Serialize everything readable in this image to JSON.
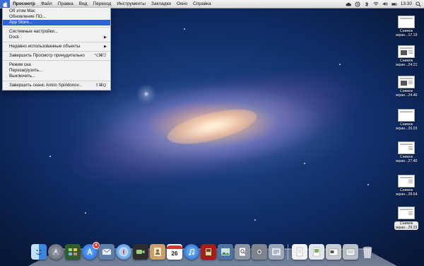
{
  "menubar": {
    "app_name": "Просмотр",
    "menus": [
      "Файл",
      "Правка",
      "Вид",
      "Переход",
      "Инструменты",
      "Закладки",
      "Окно",
      "Справка"
    ],
    "clock": "13:30"
  },
  "apple_menu": {
    "items": [
      {
        "label": "Об этом Mac"
      },
      {
        "label": "Обновление ПО..."
      },
      {
        "label": "App Store...",
        "selected": true
      },
      {
        "separator": true
      },
      {
        "label": "Системные настройки..."
      },
      {
        "label": "Dock",
        "submenu": true
      },
      {
        "separator": true
      },
      {
        "label": "Недавно использованные объекты",
        "submenu": true
      },
      {
        "separator": true
      },
      {
        "label": "Завершить Просмотр принудительно",
        "shortcut": "⌥⌘⎋"
      },
      {
        "separator": true
      },
      {
        "label": "Режим сна"
      },
      {
        "label": "Перезагрузить..."
      },
      {
        "label": "Выключить..."
      },
      {
        "separator": true
      },
      {
        "label": "Завершить сеанс Anton Spiridonov...",
        "shortcut": "⇧⌘Q"
      }
    ]
  },
  "desktop_icons": [
    {
      "line1": "Снимок",
      "line2": "экран...17.19"
    },
    {
      "line1": "Снимок",
      "line2": "экран...24.21"
    },
    {
      "line1": "Снимок",
      "line2": "экран...24.46"
    },
    {
      "line1": "Снимок",
      "line2": "экран...26.03"
    },
    {
      "line1": "Снимок",
      "line2": "экран...27.46"
    },
    {
      "line1": "Снимок",
      "line2": "экран...28.54"
    },
    {
      "line1": "Снимок",
      "line2": "экран...29.23",
      "selected": true
    }
  ],
  "dock": {
    "calendar_day": "26",
    "appstore_badge": "4",
    "apps": [
      {
        "icon": "finder-icon",
        "color": "#4a8fe0"
      },
      {
        "icon": "launchpad-icon",
        "color": "#7a7f88"
      },
      {
        "icon": "mission-control-icon",
        "color": "#3c6b3a"
      },
      {
        "icon": "app-store-icon",
        "color": "#2e7fe6"
      },
      {
        "icon": "mail-icon",
        "color": "#6d8ab0"
      },
      {
        "icon": "safari-icon",
        "color": "#3b8de0"
      },
      {
        "icon": "facetime-icon",
        "color": "#4a4a4a"
      },
      {
        "icon": "address-book-icon",
        "color": "#c9a064"
      },
      {
        "icon": "calendar-icon",
        "color": "#f2f2f2"
      },
      {
        "icon": "itunes-icon",
        "color": "#3b7fd6"
      },
      {
        "icon": "photo-booth-icon",
        "color": "#b8231f"
      },
      {
        "icon": "iphoto-icon",
        "color": "#5a7fa8"
      },
      {
        "icon": "preview-icon",
        "color": "#8a96a6"
      },
      {
        "icon": "system-preferences-icon",
        "color": "#8a8f99"
      },
      {
        "icon": "stacks-icon",
        "color": "#c7ccd3"
      }
    ]
  }
}
